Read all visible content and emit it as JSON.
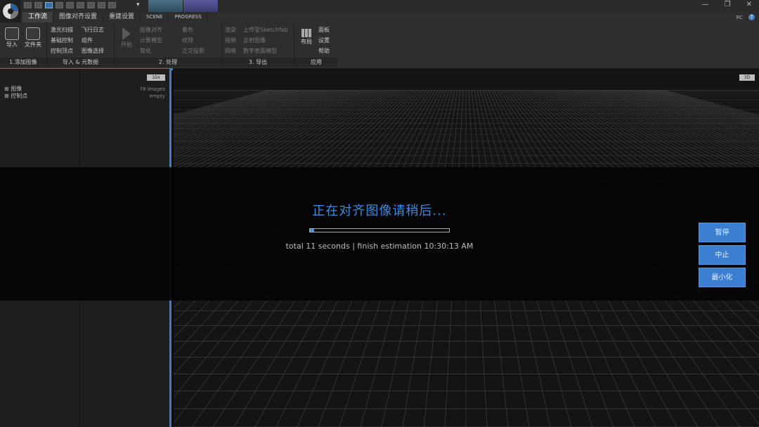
{
  "ribbon": {
    "tabs": [
      "工作流",
      "图像对齐设置",
      "重建设置",
      "SCENE",
      "PROGRESS"
    ],
    "right": {
      "rc": "RC",
      "help": "?"
    },
    "groups": {
      "add_images": {
        "label": "1.添加图像",
        "import_label": "导入",
        "folder_label": "文件夹"
      },
      "import_meta": {
        "label": "导入 & 元数据",
        "items": [
          "激光扫描",
          "飞行日志",
          "基础控制",
          "组件",
          "控制顶点",
          "图像选择"
        ]
      },
      "process": {
        "label": "2. 处理",
        "start_label": "开始",
        "items": [
          "图像对齐",
          "着色",
          "计算模型",
          "纹理",
          "简化",
          "正交投影"
        ]
      },
      "export": {
        "label": "3. 导出",
        "items": [
          "渲染",
          "上传至Sketchfab",
          "视频",
          "正射图像",
          "网格",
          "数字表面模型"
        ]
      },
      "app": {
        "label": "应用",
        "layout_label": "布局",
        "items": [
          "面板",
          "设置",
          "帮助"
        ]
      }
    }
  },
  "left_panel": {
    "tree": [
      "图像",
      "控制点"
    ],
    "tag": "1Ds",
    "info": [
      "78 images",
      "empty"
    ]
  },
  "viewport": {
    "tag": "3D"
  },
  "status": {
    "title": "正在对齐图像请稍后...",
    "progress": 0.03,
    "subtitle": "total 11 seconds | finish estimation 10:30:13 AM"
  },
  "buttons": {
    "pause": "暂停",
    "stop": "中止",
    "minimize": "最小化"
  },
  "colors": {
    "accent": "#3d7cc9",
    "title_blue": "#3d8be0",
    "button_blue": "#3c7fd1"
  }
}
